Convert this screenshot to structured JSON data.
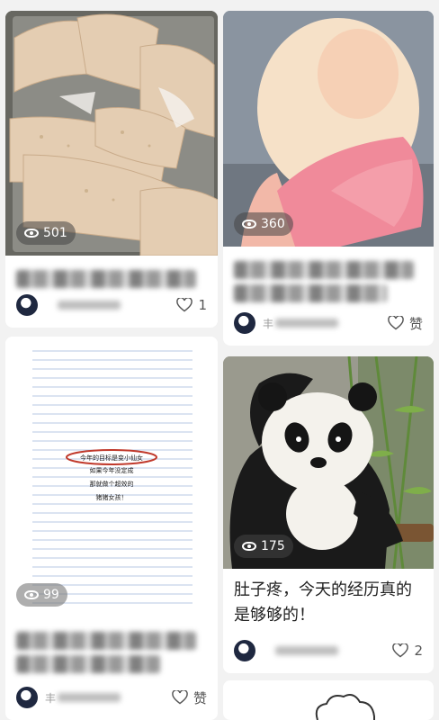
{
  "cards": [
    {
      "views": "501",
      "title_blurred": "苦苦…",
      "author_initial": "",
      "likes": "1"
    },
    {
      "views": "360",
      "author_initial": "丰",
      "likes": "赞"
    },
    {
      "views": "99",
      "author_initial": "丰",
      "likes": "赞",
      "note_lines": [
        "今年的目标是变小仙女",
        "如果今年没定成",
        "那就做个超效的",
        "猪猪女孩！"
      ]
    },
    {
      "views": "175",
      "title": "肚子疼，今天的经历真的是够够的！",
      "likes": "2"
    }
  ],
  "colors": {
    "background": "#f2f2f2",
    "card": "#ffffff",
    "note_circle": "#c0392b"
  }
}
